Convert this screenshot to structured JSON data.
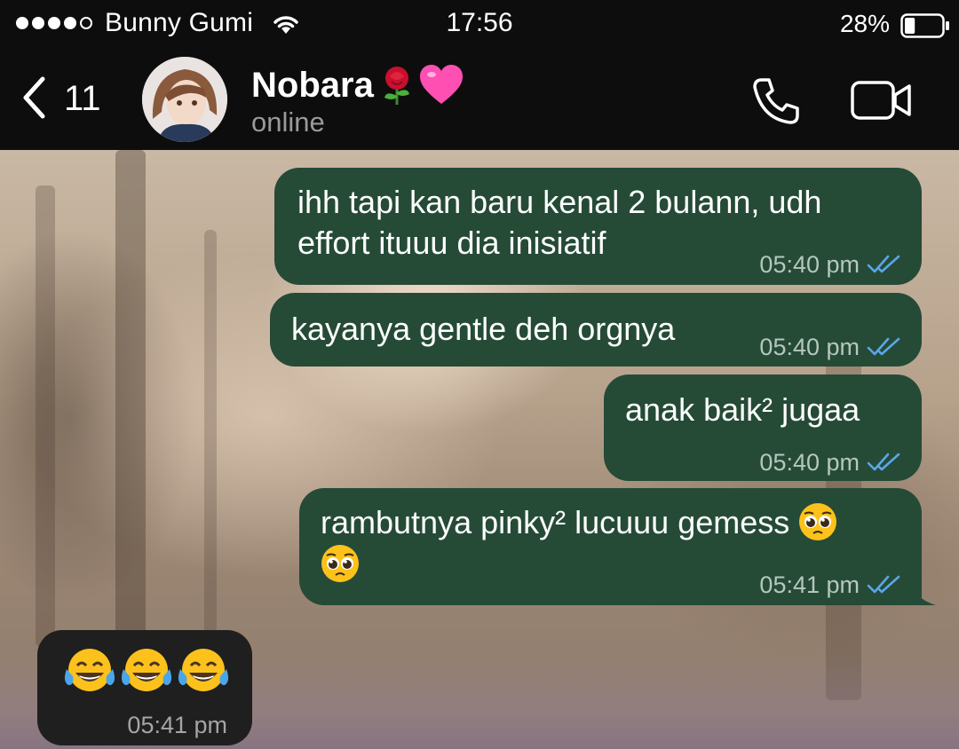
{
  "status_bar": {
    "carrier": "Bunny Gumi",
    "time": "17:56",
    "battery": "28%",
    "battery_level": 0.28,
    "signal_bars_filled": 4,
    "signal_bars_total": 5
  },
  "header": {
    "back_count": "11",
    "contact_name": "Nobara",
    "name_emojis": [
      "rose",
      "pink-heart"
    ],
    "contact_status": "online"
  },
  "messages": [
    {
      "direction": "outgoing",
      "lines": [
        "ihh tapi kan baru kenal 2 bulann, udh",
        "effort ituuu dia inisiatif"
      ],
      "time": "05:40 pm",
      "read": true
    },
    {
      "direction": "outgoing",
      "lines": [
        "kayanya gentle deh orgnya"
      ],
      "time": "05:40 pm",
      "read": true
    },
    {
      "direction": "outgoing",
      "lines": [
        "anak baik² jugaa"
      ],
      "time": "05:40 pm",
      "read": true
    },
    {
      "direction": "outgoing",
      "lines": [
        "rambutnya pinky² lucuuu gemess"
      ],
      "trailing_emojis": [
        "pleading-face",
        "pleading-face"
      ],
      "time": "05:41 pm",
      "read": true
    },
    {
      "direction": "incoming",
      "lines": [],
      "emojis": [
        "tears-of-joy",
        "tears-of-joy",
        "tears-of-joy"
      ],
      "time": "05:41 pm"
    }
  ],
  "colors": {
    "outgoing_bubble": "#254b37",
    "incoming_bubble": "#1f1f1f",
    "read_tick": "#5aa6e8",
    "header_bg": "#0d0d0d"
  }
}
